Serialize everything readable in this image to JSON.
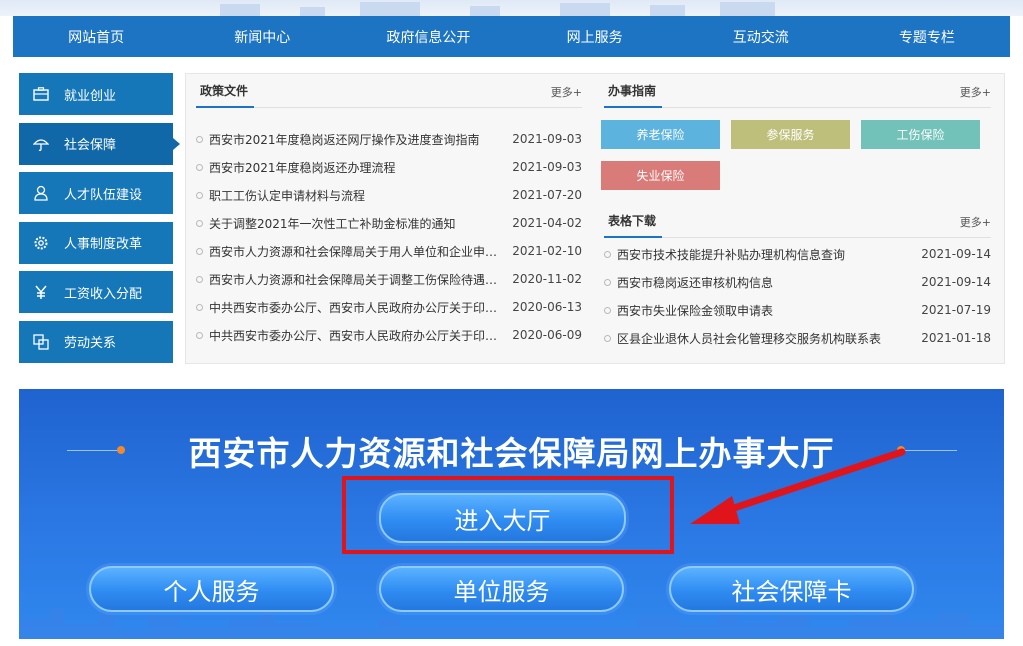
{
  "nav": {
    "items": [
      "网站首页",
      "新闻中心",
      "政府信息公开",
      "网上服务",
      "互动交流",
      "专题专栏"
    ]
  },
  "sidebar": {
    "items": [
      {
        "label": "就业创业",
        "icon": "briefcase-icon"
      },
      {
        "label": "社会保障",
        "icon": "umbrella-icon",
        "active": true
      },
      {
        "label": "人才队伍建设",
        "icon": "person-icon"
      },
      {
        "label": "人事制度改革",
        "icon": "gear-icon"
      },
      {
        "label": "工资收入分配",
        "icon": "yen-icon"
      },
      {
        "label": "劳动关系",
        "icon": "copy-icon"
      }
    ]
  },
  "policy": {
    "title": "政策文件",
    "more": "更多+",
    "items": [
      {
        "title": "西安市2021年度稳岗返还网厅操作及进度查询指南",
        "date": "2021-09-03"
      },
      {
        "title": "西安市2021年度稳岗返还办理流程",
        "date": "2021-09-03"
      },
      {
        "title": "职工工伤认定申请材料与流程",
        "date": "2021-07-20"
      },
      {
        "title": "关于调整2021年一次性工亡补助金标准的通知",
        "date": "2021-04-02"
      },
      {
        "title": "西安市人力资源和社会保障局关于用人单位和企业申请...",
        "date": "2021-02-10"
      },
      {
        "title": "西安市人力资源和社会保障局关于调整工伤保险待遇标...",
        "date": "2020-11-02"
      },
      {
        "title": "中共西安市委办公厅、西安市人民政府办公厅关于印发...",
        "date": "2020-06-13"
      },
      {
        "title": "中共西安市委办公厅、西安市人民政府办公厅关于印发...",
        "date": "2020-06-09"
      }
    ]
  },
  "guide": {
    "title": "办事指南",
    "more": "更多+",
    "tags": [
      {
        "label": "养老保险",
        "color": "#5bb3de"
      },
      {
        "label": "参保服务",
        "color": "#bfbf7c"
      },
      {
        "label": "工伤保险",
        "color": "#72c2b9"
      },
      {
        "label": "失业保险",
        "color": "#d97c79"
      }
    ]
  },
  "forms": {
    "title": "表格下载",
    "more": "更多+",
    "items": [
      {
        "title": "西安市技术技能提升补贴办理机构信息查询",
        "date": "2021-09-14"
      },
      {
        "title": "西安市稳岗返还审核机构信息",
        "date": "2021-09-14"
      },
      {
        "title": "西安市失业保险金领取申请表",
        "date": "2021-07-19"
      },
      {
        "title": "区县企业退休人员社会化管理移交服务机构联系表",
        "date": "2021-01-18"
      }
    ]
  },
  "banner": {
    "title": "西安市人力资源和社会保障局网上办事大厅",
    "enter": "进入大厅",
    "services": [
      "个人服务",
      "单位服务",
      "社会保障卡"
    ]
  },
  "colors": {
    "nav": "#1d74c2",
    "sidebar": "#1577b8",
    "annotation": "#e0141b",
    "banner": "#2b78e4"
  }
}
